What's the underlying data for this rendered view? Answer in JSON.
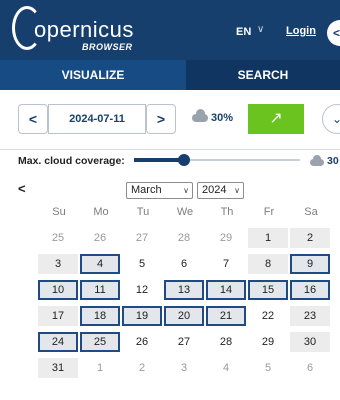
{
  "header": {
    "logo_main": "opernicus",
    "logo_sub": "BROWSER",
    "language": "EN",
    "login": "Login",
    "side_button": "<"
  },
  "tabs": [
    {
      "label": "VISUALIZE",
      "active": true
    },
    {
      "label": "SEARCH",
      "active": false
    }
  ],
  "datebar": {
    "prev": "<",
    "date": "2024-07-11",
    "next": ">",
    "cloud": "30%",
    "go_icon": "↗",
    "more_icon": "⌄"
  },
  "cloud_filter": {
    "label": "Max. cloud coverage:",
    "value": 30,
    "max_label": "30",
    "slider_fraction": 0.3
  },
  "calendar": {
    "prev": "<",
    "month": "March",
    "year": "2024",
    "weekdays": [
      "Su",
      "Mo",
      "Tu",
      "We",
      "Th",
      "Fr",
      "Sa"
    ],
    "weeks": [
      [
        {
          "d": "25",
          "o": true
        },
        {
          "d": "26",
          "o": true
        },
        {
          "d": "27",
          "o": true
        },
        {
          "d": "28",
          "o": true
        },
        {
          "d": "29",
          "o": true
        },
        {
          "d": "1"
        },
        {
          "d": "2"
        }
      ],
      [
        {
          "d": "3"
        },
        {
          "d": "4",
          "a": true
        },
        {
          "d": "5"
        },
        {
          "d": "6"
        },
        {
          "d": "7"
        },
        {
          "d": "8"
        },
        {
          "d": "9",
          "a": true
        }
      ],
      [
        {
          "d": "10",
          "a": true
        },
        {
          "d": "11",
          "a": true
        },
        {
          "d": "12"
        },
        {
          "d": "13",
          "a": true
        },
        {
          "d": "14",
          "a": true
        },
        {
          "d": "15",
          "a": true
        },
        {
          "d": "16",
          "a": true
        }
      ],
      [
        {
          "d": "17"
        },
        {
          "d": "18",
          "a": true
        },
        {
          "d": "19",
          "a": true
        },
        {
          "d": "20",
          "a": true
        },
        {
          "d": "21",
          "a": true
        },
        {
          "d": "22"
        },
        {
          "d": "23"
        }
      ],
      [
        {
          "d": "24",
          "a": true
        },
        {
          "d": "25",
          "a": true
        },
        {
          "d": "26"
        },
        {
          "d": "27"
        },
        {
          "d": "28"
        },
        {
          "d": "29"
        },
        {
          "d": "30"
        }
      ],
      [
        {
          "d": "31"
        },
        {
          "d": "1",
          "o": true
        },
        {
          "d": "2",
          "o": true
        },
        {
          "d": "3",
          "o": true
        },
        {
          "d": "4",
          "o": true
        },
        {
          "d": "5",
          "o": true
        },
        {
          "d": "6",
          "o": true
        }
      ]
    ]
  },
  "colors": {
    "header": "#173f6e",
    "accent_green": "#6ac31f",
    "available_border": "#1f4a83"
  }
}
